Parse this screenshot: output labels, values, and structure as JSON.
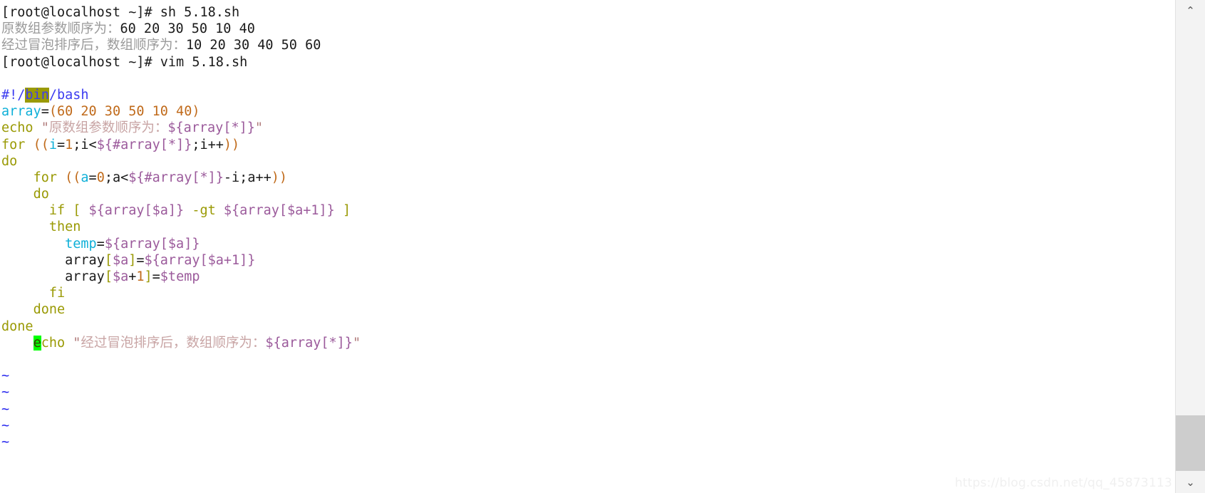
{
  "window": {
    "background": "#ffffff",
    "foreground": "#1a1a1a"
  },
  "terminal": {
    "shell_lines": [
      {
        "prompt": "[root@localhost ~]# ",
        "command": "sh 5.18.sh"
      },
      {
        "prompt": "[root@localhost ~]# ",
        "command": "vim 5.18.sh"
      }
    ],
    "output_lines": [
      "原数组参数顺序为：60 20 30 50 10 40",
      "经过冒泡排序后，数组顺序为：10 20 30 40 50 60"
    ],
    "output_label_1": "原数组参数顺序为：",
    "output_values_1": "60 20 30 50 10 40",
    "output_label_2": "经过冒泡排序后，数组顺序为：",
    "output_values_2": "10 20 30 40 50 60"
  },
  "editor": {
    "name": "vim",
    "filename": "5.18.sh",
    "search_highlight": "bin",
    "cursor_char": "e",
    "empty_line_marker": "~",
    "empty_line_count": 5,
    "script": {
      "shebang_hash": "#!",
      "shebang_slash1": "/",
      "shebang_bin": "bin",
      "shebang_slash2": "/",
      "shebang_bash": "bash",
      "l2_var": "array",
      "l2_eq": "=",
      "l2_open": "(",
      "l2_values": "60 20 30 50 10 40",
      "l2_close": ")",
      "l3_kw": "echo",
      "l3_quote_open": "\"",
      "l3_text": "原数组参数顺序为：",
      "l3_subst": "${array[*]}",
      "l3_quote_close": "\"",
      "l4_kw": "for",
      "l4_open": "((",
      "l4_i": "i",
      "l4_eq": "=",
      "l4_one": "1",
      "l4_mid": ";i<",
      "l4_subst": "${#array[*]}",
      "l4_tail": ";i++",
      "l4_close": "))",
      "l5_kw": "do",
      "l6_kw": "for",
      "l6_open": "((",
      "l6_a": "a",
      "l6_eq": "=",
      "l6_zero": "0",
      "l6_mid": ";a<",
      "l6_subst": "${#array[*]}",
      "l6_minus": "-i;a++",
      "l6_close": "))",
      "l7_kw": "do",
      "l8_kw": "if",
      "l8_lb": "[",
      "l8_subst1": "${array[$a]}",
      "l8_op": "-gt",
      "l8_subst2": "${array[$a+1]}",
      "l8_rb": "]",
      "l9_kw": "then",
      "l10_var": "temp",
      "l10_eq": "=",
      "l10_subst": "${array[$a]}",
      "l11_name": "array",
      "l11_lb": "[",
      "l11_idx": "$a",
      "l11_rb": "]",
      "l11_eq": "=",
      "l11_subst": "${array[$a+1]}",
      "l12_name": "array",
      "l12_lb": "[",
      "l12_idx": "$a",
      "l12_plus": "+",
      "l12_one": "1",
      "l12_rb": "]",
      "l12_eq": "=",
      "l12_val": "$temp",
      "l13_kw": "fi",
      "l14_kw": "done",
      "l15_kw": "done",
      "l16_cursor": "e",
      "l16_kw_rest": "cho",
      "l16_quote_open": "\"",
      "l16_text": "经过冒泡排序后，数组顺序为：",
      "l16_subst": "${array[*]}",
      "l16_quote_close": "\""
    }
  },
  "scrollbar": {
    "up_arrow": "⌃",
    "down_arrow": "⌄"
  },
  "watermark": {
    "text": "https://blog.csdn.net/qq_45873113"
  },
  "colors": {
    "keyword": "#9a9a05",
    "variable": "#0fb0d8",
    "substitution": "#9b5a9b",
    "string": "#c8a4a4",
    "constant": "#c06a1a",
    "shebang": "#3c3cf0",
    "cursor": "#00ff00",
    "search_highlight": "#9a9a05",
    "tilde": "#2222ee",
    "output": "#9a9a9a"
  }
}
